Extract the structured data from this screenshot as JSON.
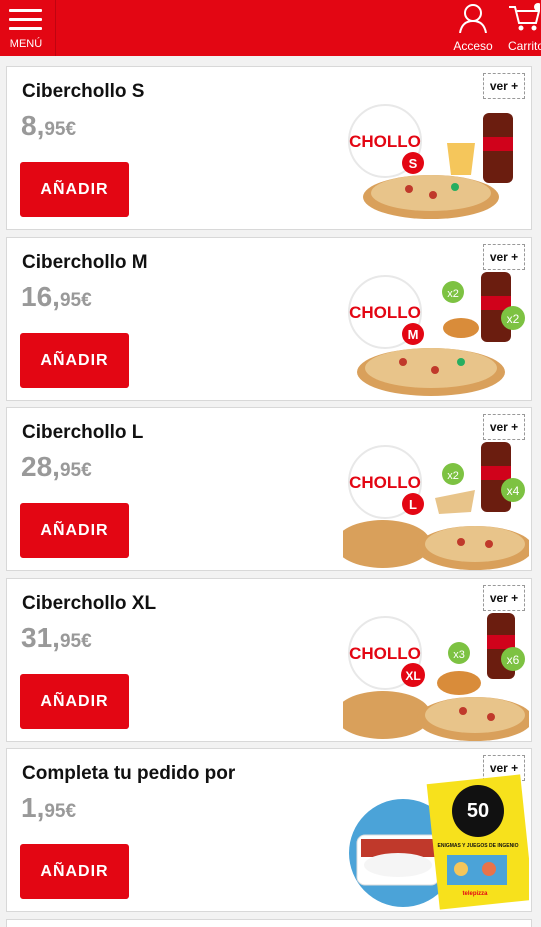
{
  "header": {
    "menu_label": "MENÚ",
    "acceso_label": "Acceso",
    "carrito_label": "Carrito",
    "brand_color": "#e30613"
  },
  "products": [
    {
      "name": "Ciberchollo S",
      "price_int": "8,",
      "price_dec": "95€",
      "add_label": "AÑADIR",
      "ver_label": "ver +",
      "badge": "CHOLLO",
      "size": "S",
      "extras": []
    },
    {
      "name": "Ciberchollo M",
      "price_int": "16,",
      "price_dec": "95€",
      "add_label": "AÑADIR",
      "ver_label": "ver +",
      "badge": "CHOLLO",
      "size": "M",
      "extras": [
        "x2",
        "x2"
      ]
    },
    {
      "name": "Ciberchollo L",
      "price_int": "28,",
      "price_dec": "95€",
      "add_label": "AÑADIR",
      "ver_label": "ver +",
      "badge": "CHOLLO",
      "size": "L",
      "extras": [
        "x2",
        "x4"
      ]
    },
    {
      "name": "Ciberchollo XL",
      "price_int": "31,",
      "price_dec": "95€",
      "add_label": "AÑADIR",
      "ver_label": "ver +",
      "badge": "CHOLLO",
      "size": "XL",
      "extras": [
        "x3",
        "x6"
      ]
    },
    {
      "name": "Completa tu pedido por",
      "price_int": "1,",
      "price_dec": "95€",
      "add_label": "AÑADIR",
      "ver_label": "ver +",
      "book_number": "50",
      "book_title": "ENIGMAS Y JUEGOS DE INGENIO",
      "book_brand": "telepizza"
    }
  ]
}
